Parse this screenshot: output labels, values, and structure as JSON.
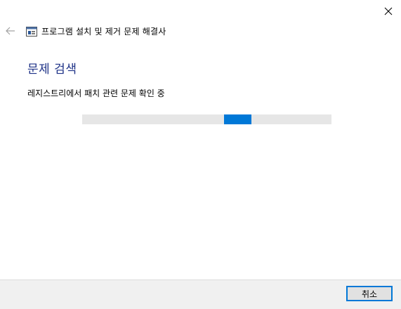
{
  "window": {
    "title": "프로그램 설치 및 제거 문제 해결사"
  },
  "main": {
    "heading": "문제 검색",
    "status": "레지스트리에서 패치 관련 문제 확인 중"
  },
  "progress": {
    "style": "marquee",
    "indicator_start_fraction": 0.569,
    "indicator_width_fraction": 0.11
  },
  "footer": {
    "cancel_label": "취소"
  },
  "colors": {
    "heading": "#1e3287",
    "accent": "#0078d7",
    "track": "#e6e6e6",
    "footer": "#f0f0f0"
  },
  "icons": {
    "back": "back-arrow-icon",
    "close": "close-icon",
    "app": "troubleshooter-window-icon"
  }
}
